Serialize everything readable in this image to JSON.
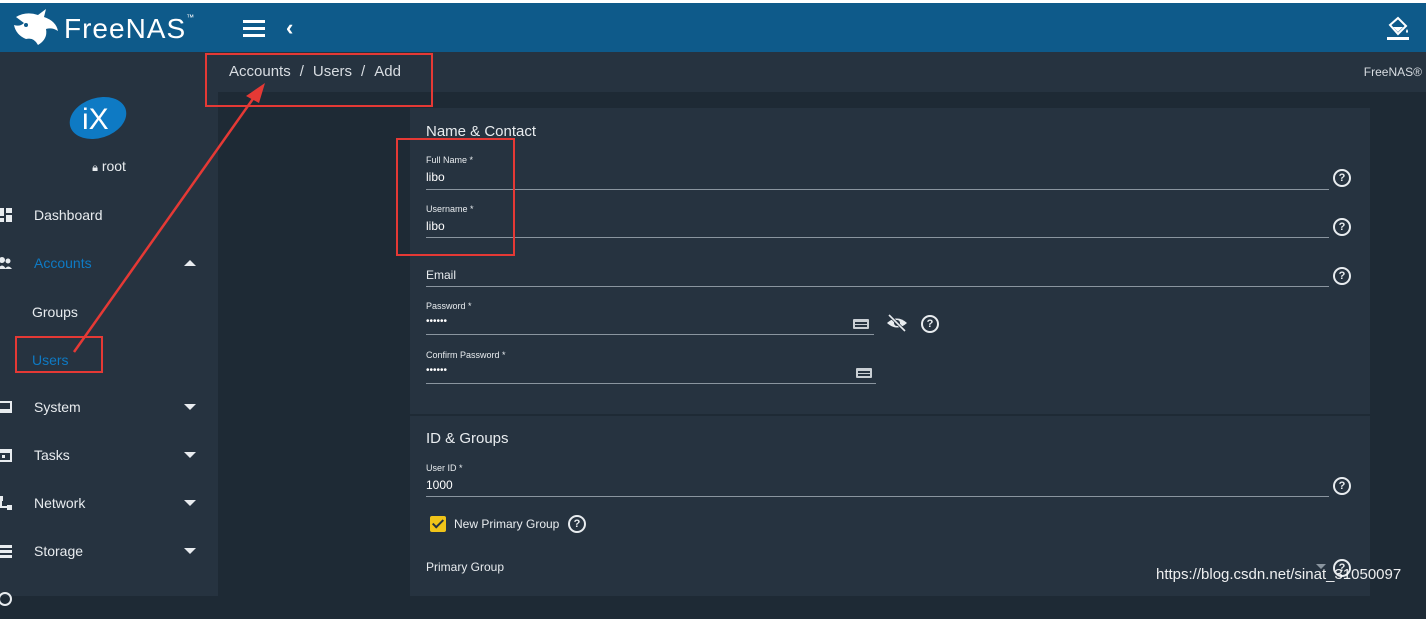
{
  "app": {
    "logo_text": "FreeNAS",
    "logo_tm": "™",
    "brand_right": "FreeNAS®"
  },
  "sidebar": {
    "user": "root",
    "items": [
      {
        "label": "Dashboard",
        "icon": "dashboard-icon"
      },
      {
        "label": "Accounts",
        "icon": "people-icon",
        "expanded": true,
        "active": true
      },
      {
        "label": "System",
        "icon": "laptop-icon"
      },
      {
        "label": "Tasks",
        "icon": "calendar-icon"
      },
      {
        "label": "Network",
        "icon": "network-icon"
      },
      {
        "label": "Storage",
        "icon": "storage-icon"
      }
    ],
    "subitems": [
      {
        "label": "Groups"
      },
      {
        "label": "Users",
        "active": true
      }
    ]
  },
  "breadcrumb": {
    "parts": [
      "Accounts",
      "Users",
      "Add"
    ],
    "sep": "/"
  },
  "form": {
    "name_contact": {
      "title": "Name & Contact",
      "full_name": {
        "label": "Full Name *",
        "value": "libo"
      },
      "username": {
        "label": "Username *",
        "value": "libo"
      },
      "email": {
        "placeholder": "Email"
      },
      "password": {
        "label": "Password *",
        "value": "••••••"
      },
      "confirm_password": {
        "label": "Confirm Password *",
        "value": "••••••"
      }
    },
    "id_groups": {
      "title": "ID & Groups",
      "user_id": {
        "label": "User ID *",
        "value": "1000"
      },
      "new_primary_group": {
        "label": "New Primary Group",
        "checked": true
      },
      "primary_group": {
        "placeholder": "Primary Group"
      }
    }
  },
  "watermark": "https://blog.csdn.net/sinat_31050097",
  "colors": {
    "topbar": "#0e5a8a",
    "accent": "#0e7ac4",
    "annotation": "#e53935",
    "checkbox": "#f0c419"
  }
}
